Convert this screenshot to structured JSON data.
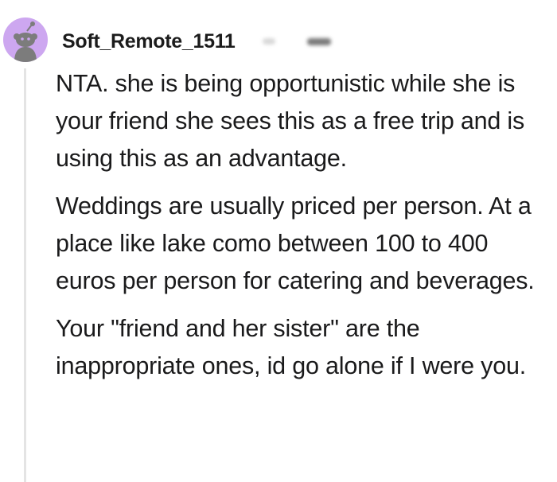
{
  "comment": {
    "avatar_icon": "snoo-avatar-icon",
    "avatar_color": "#cda7f0",
    "username": "Soft_Remote_1511",
    "paragraphs": [
      "NTA. she is being opportunistic while she is your friend she sees this as a free trip and is using this as an advantage.",
      "Weddings are usually priced per person. At a place like lake como between 100 to 400 euros per person for catering and beverages.",
      "Your \"friend and her sister\" are the inappropriate ones, id go alone if I were you."
    ]
  }
}
